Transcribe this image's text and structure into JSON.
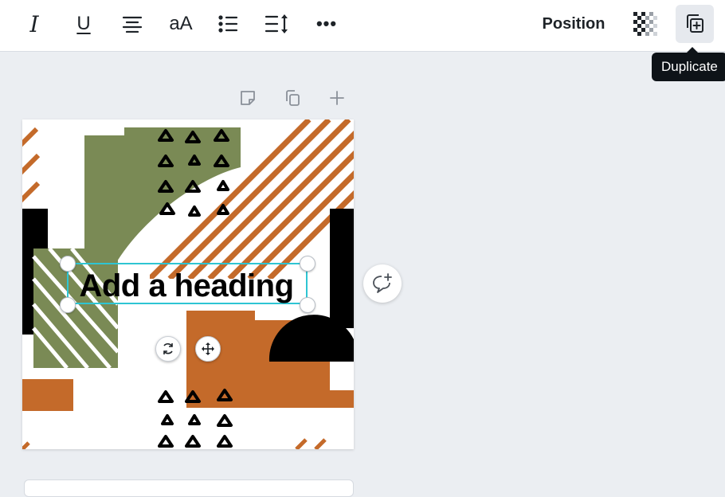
{
  "toolbar": {
    "italic_label": "I",
    "underline_label": "U",
    "case_label": "aA",
    "more_label": "•••",
    "position_label": "Position"
  },
  "tooltip": {
    "duplicate": "Duplicate"
  },
  "canvas": {
    "heading_text": "Add a heading"
  },
  "colors": {
    "olive": "#7a8a55",
    "rust": "#c46a2a",
    "black": "#000000",
    "selection": "#2ec5d3",
    "background": "#ebeef2"
  },
  "icons": [
    "italic-icon",
    "underline-icon",
    "align-center-icon",
    "letter-case-icon",
    "bullet-list-icon",
    "line-spacing-icon",
    "more-icon",
    "transparency-icon",
    "duplicate-icon",
    "note-icon",
    "copy-page-icon",
    "add-page-icon",
    "rotate-icon",
    "move-icon",
    "add-comment-icon"
  ]
}
